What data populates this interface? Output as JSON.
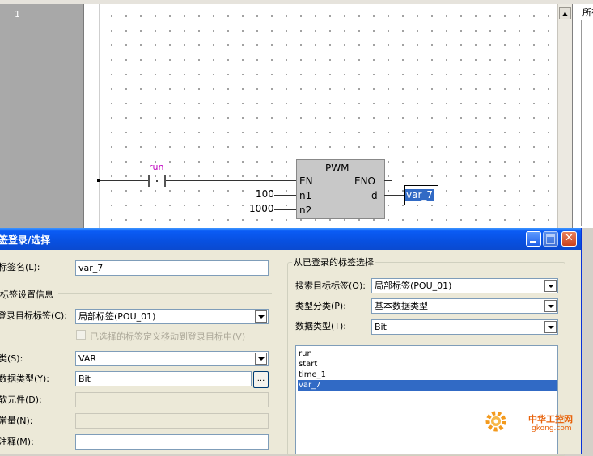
{
  "editor": {
    "row_number": "1",
    "right_panel_text": "所有",
    "scroll_up": "▲",
    "contact_name": "run",
    "block_name": "PWM",
    "block_inputs": [
      "EN",
      "n1",
      "n2"
    ],
    "block_outputs": [
      "ENO",
      "d"
    ],
    "const_n1": "100",
    "const_n2": "1000",
    "output_var": "var_7"
  },
  "dialog": {
    "title": "签登录/选择",
    "buttons": {
      "close": "✕"
    },
    "left": {
      "tag_name_label": "标签名(L):",
      "tag_name_value": "var_7",
      "settings_group": "标签设置信息",
      "register_target_label": "登录目标标签(C):",
      "register_target_value": "局部标签(POU_01)",
      "move_checkbox_label": "已选择的标签定义移动到登录目标中(V)",
      "class_label": "类(S):",
      "class_value": "VAR",
      "data_type_label": "数据类型(Y):",
      "data_type_value": "Bit",
      "ellipsis": "...",
      "soft_element_label": "软元件(D):",
      "constant_label": "常量(N):",
      "comment_label": "注释(M):"
    },
    "right": {
      "group_title": "从已登录的标签选择",
      "search_target_label": "搜索目标标签(O):",
      "search_target_value": "局部标签(POU_01)",
      "type_class_label": "类型分类(P):",
      "type_class_value": "基本数据类型",
      "data_type_label": "数据类型(T):",
      "data_type_value": "Bit",
      "tags": [
        "run",
        "start",
        "time_1",
        "var_7"
      ],
      "selected_index": 3
    }
  },
  "watermark": {
    "name": "中华工控网",
    "url": "gkong.com"
  },
  "colors": {
    "selection": "#316ac5",
    "contact_label": "#c000c0",
    "titlebar": "#0a5bf5",
    "watermark": "#e8620a"
  }
}
